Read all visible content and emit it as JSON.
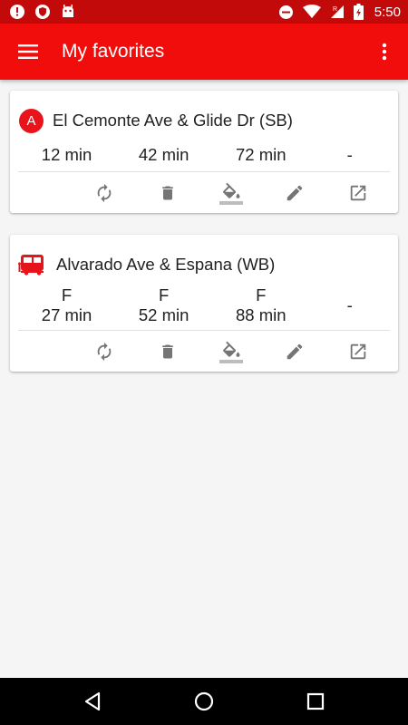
{
  "status_bar": {
    "time": "5:50",
    "left_icons": [
      "alert-download-icon",
      "shield-vpn-icon",
      "android-icon"
    ],
    "right_icons": [
      "dnd-icon",
      "wifi-icon",
      "signal-icon",
      "battery-icon"
    ]
  },
  "app_bar": {
    "title": "My favorites",
    "menu_icon": "hamburger-menu-icon",
    "overflow_icon": "more-vert-icon"
  },
  "favorites": [
    {
      "route_badge": "A",
      "stop_name": "El Cemonte Ave & Glide Dr (SB)",
      "arrivals": [
        {
          "label": "",
          "time": "12 min"
        },
        {
          "label": "",
          "time": "42 min"
        },
        {
          "label": "",
          "time": "72 min"
        },
        {
          "label": "",
          "time": "-"
        }
      ]
    },
    {
      "route_badge": "",
      "stop_name": "Alvarado Ave & Espana (WB)",
      "arrivals": [
        {
          "label": "F",
          "time": "27 min"
        },
        {
          "label": "F",
          "time": "52 min"
        },
        {
          "label": "F",
          "time": "88 min"
        },
        {
          "label": "",
          "time": "-"
        }
      ]
    }
  ],
  "actions": [
    "refresh-icon",
    "delete-icon",
    "color-fill-icon",
    "edit-icon",
    "open-in-new-icon"
  ],
  "colors": {
    "status_bar": "#c20a0a",
    "app_bar": "#f20d0d",
    "accent": "#e8141c",
    "icon_grey": "#757575",
    "background": "#f5f5f5"
  }
}
